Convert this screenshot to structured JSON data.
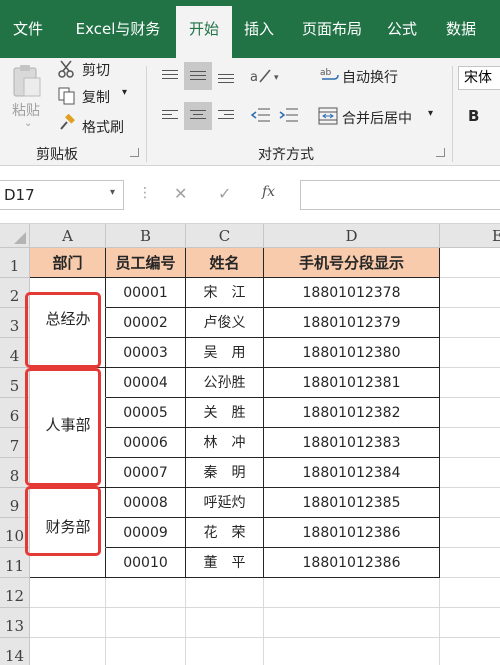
{
  "tabs": [
    "文件",
    "Excel与财务",
    "开始",
    "插入",
    "页面布局",
    "公式",
    "数据"
  ],
  "active_tab": "开始",
  "clipboard": {
    "paste": "粘贴",
    "cut": "剪切",
    "copy": "复制",
    "format_painter": "格式刷",
    "group_label": "剪贴板"
  },
  "alignment": {
    "wrap_text": "自动换行",
    "merge_center": "合并后居中",
    "group_label": "对齐方式"
  },
  "font": {
    "name": "宋体",
    "bold": "B"
  },
  "formula_bar": {
    "name_box": "D17",
    "fx": "fx",
    "formula": ""
  },
  "columns": [
    "A",
    "B",
    "C",
    "D",
    "E"
  ],
  "rows": [
    "1",
    "2",
    "3",
    "4",
    "5",
    "6",
    "7",
    "8",
    "9",
    "10",
    "11",
    "12",
    "13",
    "14"
  ],
  "header": {
    "dept": "部门",
    "emp_id": "员工编号",
    "name": "姓名",
    "phone": "手机号分段显示"
  },
  "employees": [
    {
      "id": "00001",
      "name": "宋　江",
      "phone": "18801012378"
    },
    {
      "id": "00002",
      "name": "卢俊义",
      "phone": "18801012379"
    },
    {
      "id": "00003",
      "name": "吴　用",
      "phone": "18801012380"
    },
    {
      "id": "00004",
      "name": "公孙胜",
      "phone": "18801012381"
    },
    {
      "id": "00005",
      "name": "关　胜",
      "phone": "18801012382"
    },
    {
      "id": "00006",
      "name": "林　冲",
      "phone": "18801012383"
    },
    {
      "id": "00007",
      "name": "秦　明",
      "phone": "18801012384"
    },
    {
      "id": "00008",
      "name": "呼延灼",
      "phone": "18801012385"
    },
    {
      "id": "00009",
      "name": "花　荣",
      "phone": "18801012386"
    },
    {
      "id": "00010",
      "name": "董　平",
      "phone": "18801012386"
    }
  ],
  "departments": [
    "总经办",
    "人事部",
    "财务部"
  ],
  "colors": {
    "ribbon_green": "#217346",
    "header_fill": "#f8cbad",
    "highlight_red": "#e53935"
  }
}
